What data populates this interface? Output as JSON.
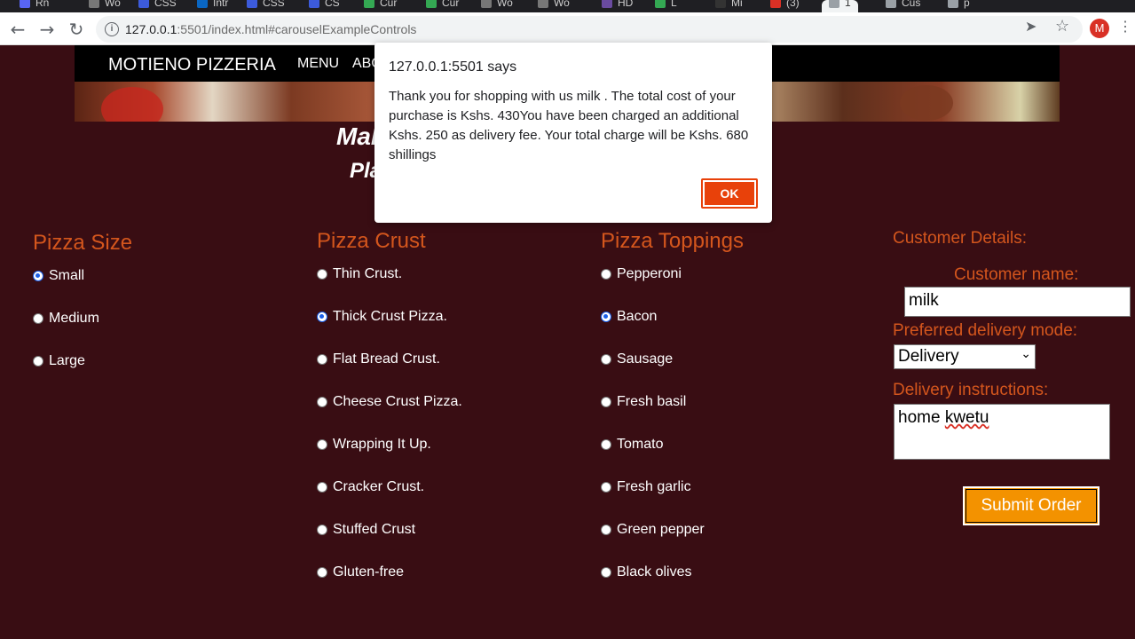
{
  "browser": {
    "tabs": [
      {
        "label": "Rn",
        "color": "#5865f2"
      },
      {
        "label": "Wo",
        "color": "#777777"
      },
      {
        "label": "CSS",
        "color": "#3c5bdb"
      },
      {
        "label": "Intr",
        "color": "#0a66c2"
      },
      {
        "label": "CSS",
        "color": "#3c5bdb"
      },
      {
        "label": "CS",
        "color": "#3c5bdb"
      },
      {
        "label": "Cur",
        "color": "#34a853"
      },
      {
        "label": "Cur",
        "color": "#34a853"
      },
      {
        "label": "Wo",
        "color": "#777777"
      },
      {
        "label": "Wo",
        "color": "#777777"
      },
      {
        "label": "HD",
        "color": "#6a4ba0"
      },
      {
        "label": "L",
        "color": "#34a853"
      },
      {
        "label": "Mi",
        "color": "#333333"
      },
      {
        "label": "(3)",
        "color": "#d93025"
      },
      {
        "label": "1",
        "color": "#9aa0a6"
      },
      {
        "label": "Cus",
        "color": "#9aa0a6"
      },
      {
        "label": "p",
        "color": "#9aa0a6"
      }
    ],
    "url_host": "127.0.0.1",
    "url_rest": ":5501/index.html#carouselExampleControls",
    "profile_initial": "M",
    "icons": {
      "back": "back-arrow-icon",
      "forward": "forward-arrow-icon",
      "reload": "reload-icon",
      "info": "info-icon",
      "send": "send-icon",
      "star": "bookmark-star-icon",
      "menu": "menu-dots-icon"
    }
  },
  "navbar": {
    "brand": "MOTIENO PIZZERIA",
    "menu": "MENU",
    "about": "ABO"
  },
  "hero": {
    "headline": "Mal",
    "subheadline": "Pla"
  },
  "size": {
    "title": "Pizza Size",
    "options": [
      {
        "label": "Small",
        "checked": true
      },
      {
        "label": "Medium",
        "checked": false
      },
      {
        "label": "Large",
        "checked": false
      }
    ]
  },
  "crust": {
    "title": "Pizza Crust",
    "options": [
      {
        "label": "Thin Crust.",
        "checked": false
      },
      {
        "label": "Thick Crust Pizza.",
        "checked": true
      },
      {
        "label": "Flat Bread Crust.",
        "checked": false
      },
      {
        "label": "Cheese Crust Pizza.",
        "checked": false
      },
      {
        "label": "Wrapping It Up.",
        "checked": false
      },
      {
        "label": "Cracker Crust.",
        "checked": false
      },
      {
        "label": "Stuffed Crust",
        "checked": false
      },
      {
        "label": "Gluten-free",
        "checked": false
      }
    ]
  },
  "toppings": {
    "title": "Pizza Toppings",
    "options": [
      {
        "label": "Pepperoni",
        "checked": false
      },
      {
        "label": "Bacon",
        "checked": true
      },
      {
        "label": "Sausage",
        "checked": false
      },
      {
        "label": "Fresh basil",
        "checked": false
      },
      {
        "label": "Tomato",
        "checked": false
      },
      {
        "label": "Fresh garlic",
        "checked": false
      },
      {
        "label": "Green pepper",
        "checked": false
      },
      {
        "label": "Black olives",
        "checked": false
      }
    ]
  },
  "customer": {
    "title": "Customer Details:",
    "name_label": "Customer name:",
    "name_value": "milk",
    "mode_label": "Preferred delivery mode:",
    "mode_value": "Delivery",
    "instructions_label": "Delivery instructions:",
    "instructions_word1": "home",
    "instructions_word2": "kwetu",
    "submit": "Submit Order"
  },
  "dialog": {
    "title": "127.0.0.1:5501 says",
    "message": "Thank you for shopping with us milk . The total cost of your purchase is Kshs. 430You have been charged an additional Kshs. 250 as delivery fee. Your total charge will be Kshs. 680 shillings",
    "ok": "OK"
  },
  "colors": {
    "page_bg": "#390d13",
    "accent": "#d4561d",
    "submit_bg": "#f39200",
    "ok_bg": "#e8410a"
  }
}
